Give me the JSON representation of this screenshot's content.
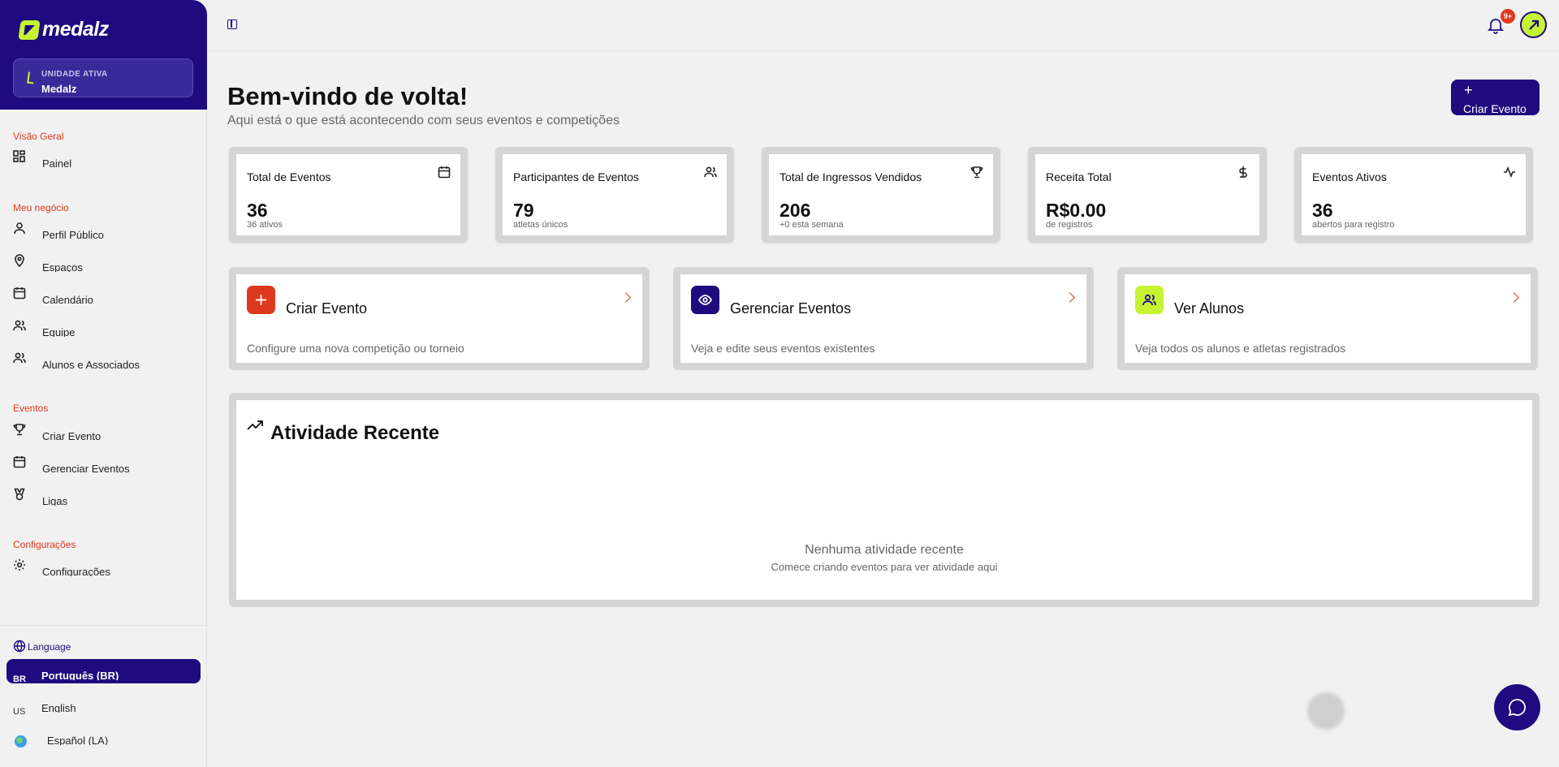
{
  "brand": {
    "name": "medalz",
    "accent": "#1f0a80",
    "lime": "#c6f432",
    "red": "#e0381f"
  },
  "unit": {
    "label": "UNIDADE ATIVA",
    "name": "Medalz"
  },
  "sidebar": {
    "sections": [
      {
        "title": "Visão Geral",
        "items": [
          {
            "label": "Painel",
            "icon": "grid-icon"
          }
        ]
      },
      {
        "title": "Meu negócio",
        "items": [
          {
            "label": "Perfil Público",
            "icon": "user-icon"
          },
          {
            "label": "Espaços",
            "icon": "map-pin-icon"
          },
          {
            "label": "Calendário",
            "icon": "calendar-icon"
          },
          {
            "label": "Equipe",
            "icon": "users-icon"
          },
          {
            "label": "Alunos e Associados",
            "icon": "users-icon"
          }
        ]
      },
      {
        "title": "Eventos",
        "items": [
          {
            "label": "Criar Evento",
            "icon": "trophy-icon"
          },
          {
            "label": "Gerenciar Eventos",
            "icon": "calendar-icon"
          },
          {
            "label": "Ligas",
            "icon": "medal-icon"
          }
        ]
      },
      {
        "title": "Configurações",
        "items": [
          {
            "label": "Configurações",
            "icon": "gear-icon"
          }
        ]
      }
    ]
  },
  "language": {
    "title": "Language",
    "options": [
      {
        "code": "BR",
        "name": "Português (BR)",
        "active": true
      },
      {
        "code": "US",
        "name": "English",
        "active": false
      },
      {
        "code": "",
        "name": "Español (LA)",
        "active": false
      }
    ]
  },
  "topbar": {
    "notification_count": "9+"
  },
  "header": {
    "title": "Bem-vindo de volta!",
    "subtitle": "Aqui está o que está acontecendo com seus eventos e competições",
    "create_button": "Criar Evento"
  },
  "stats": [
    {
      "label": "Total de Eventos",
      "value": "36",
      "sub": "36 ativos",
      "icon": "calendar-icon"
    },
    {
      "label": "Participantes de Eventos",
      "value": "79",
      "sub": "atletas únicos",
      "icon": "users-icon"
    },
    {
      "label": "Total de Ingressos Vendidos",
      "value": "206",
      "sub": "+0 esta semana",
      "icon": "trophy-icon"
    },
    {
      "label": "Receita Total",
      "value": "R$0.00",
      "sub": "de registros",
      "icon": "dollar-icon"
    },
    {
      "label": "Eventos Ativos",
      "value": "36",
      "sub": "abertos para registro",
      "icon": "activity-icon"
    }
  ],
  "actions": [
    {
      "title": "Criar Evento",
      "desc": "Configure uma nova competição ou torneio",
      "icon": "plus-icon",
      "color": "#e0381f"
    },
    {
      "title": "Gerenciar Eventos",
      "desc": "Veja e edite seus eventos existentes",
      "icon": "eye-icon",
      "color": "#1f0a80"
    },
    {
      "title": "Ver Alunos",
      "desc": "Veja todos os alunos e atletas registrados",
      "icon": "users-icon",
      "color": "#c6f432"
    }
  ],
  "activity": {
    "title": "Atividade Recente",
    "empty_title": "Nenhuma atividade recente",
    "empty_sub": "Comece criando eventos para ver atividade aqui"
  }
}
